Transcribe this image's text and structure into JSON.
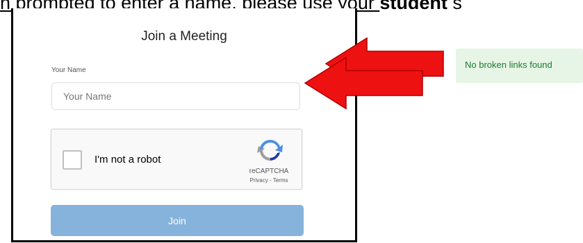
{
  "caption": {
    "prefix": "n prompted to enter a name, please use your ",
    "bold": "student",
    "suffix": " s"
  },
  "dialog": {
    "title": "Join a Meeting",
    "name_label": "Your Name",
    "name_placeholder": "Your Name",
    "captcha": {
      "label": "I'm not a robot",
      "brand": "reCAPTCHA",
      "links": "Privacy - Terms",
      "icon": "recaptcha-logo"
    },
    "join_label": "Join"
  },
  "arrows": {
    "color": "#ee1111",
    "count": 2
  },
  "status": {
    "text": "No broken links found",
    "color": "#1d7a2e",
    "background": "#e6f5e6"
  },
  "colors": {
    "join_button": "#86b3db"
  }
}
